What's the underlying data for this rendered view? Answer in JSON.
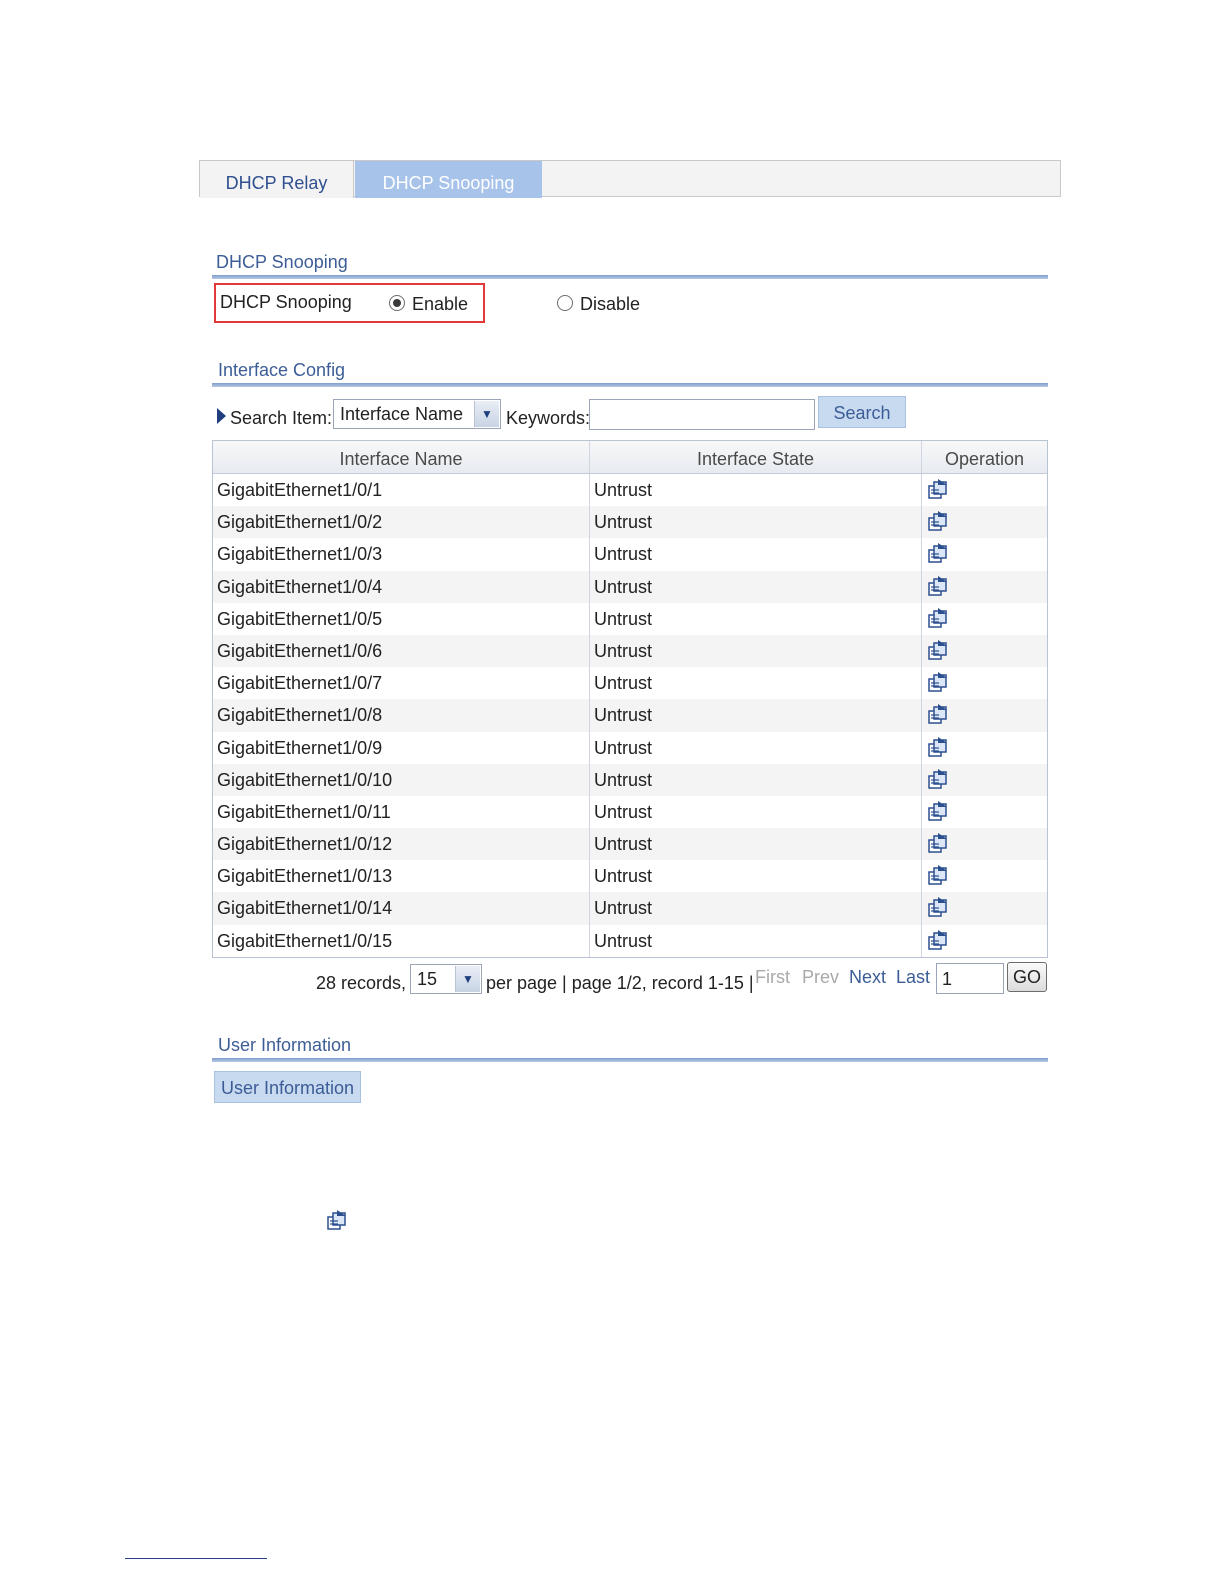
{
  "tabs": [
    {
      "label": "DHCP Relay",
      "active": false
    },
    {
      "label": "DHCP Snooping",
      "active": true
    }
  ],
  "snooping_section": {
    "title": "DHCP Snooping",
    "field_label": "DHCP Snooping",
    "enable_label": "Enable",
    "disable_label": "Disable",
    "selected": "Enable"
  },
  "interface_section": {
    "title": "Interface Config",
    "search_item_label": "Search Item:",
    "search_item_value": "Interface Name",
    "keywords_label": "Keywords:",
    "keywords_value": "",
    "search_button": "Search"
  },
  "table": {
    "headers": [
      "Interface Name",
      "Interface State",
      "Operation"
    ],
    "rows": [
      {
        "name": "GigabitEthernet1/0/1",
        "state": "Untrust"
      },
      {
        "name": "GigabitEthernet1/0/2",
        "state": "Untrust"
      },
      {
        "name": "GigabitEthernet1/0/3",
        "state": "Untrust"
      },
      {
        "name": "GigabitEthernet1/0/4",
        "state": "Untrust"
      },
      {
        "name": "GigabitEthernet1/0/5",
        "state": "Untrust"
      },
      {
        "name": "GigabitEthernet1/0/6",
        "state": "Untrust"
      },
      {
        "name": "GigabitEthernet1/0/7",
        "state": "Untrust"
      },
      {
        "name": "GigabitEthernet1/0/8",
        "state": "Untrust"
      },
      {
        "name": "GigabitEthernet1/0/9",
        "state": "Untrust"
      },
      {
        "name": "GigabitEthernet1/0/10",
        "state": "Untrust"
      },
      {
        "name": "GigabitEthernet1/0/11",
        "state": "Untrust"
      },
      {
        "name": "GigabitEthernet1/0/12",
        "state": "Untrust"
      },
      {
        "name": "GigabitEthernet1/0/13",
        "state": "Untrust"
      },
      {
        "name": "GigabitEthernet1/0/14",
        "state": "Untrust"
      },
      {
        "name": "GigabitEthernet1/0/15",
        "state": "Untrust"
      }
    ],
    "operation_icon": "modify-icon"
  },
  "pager": {
    "records_text": "28 records,",
    "per_page_value": "15",
    "page_text": "per page | page 1/2, record 1-15 |",
    "first": "First",
    "prev": "Prev",
    "next": "Next",
    "last": "Last",
    "page_input": "1",
    "go": "GO"
  },
  "user_section": {
    "title": "User Information",
    "button": "User Information"
  },
  "colors": {
    "active_tab": "#a7c3ea",
    "section_title": "#3d5d96",
    "highlight_box": "#e23a3a"
  }
}
